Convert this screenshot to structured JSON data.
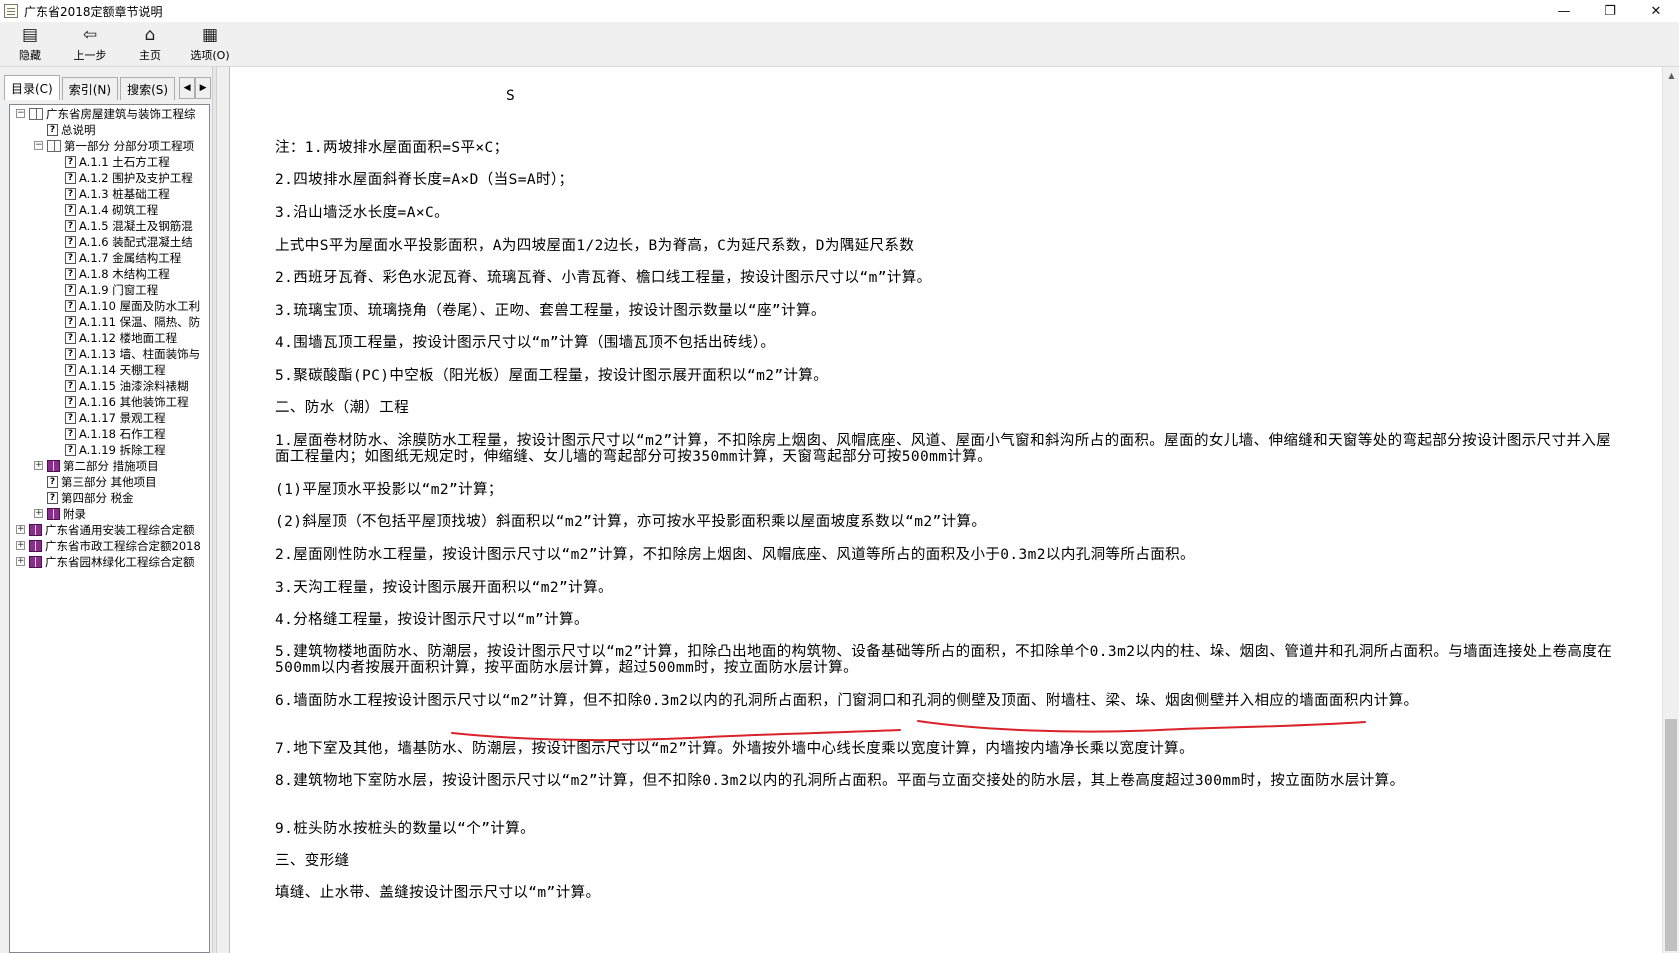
{
  "window": {
    "title": "广东省2018定额章节说明",
    "controls": [
      "—",
      "❐",
      "✕"
    ]
  },
  "toolbar": [
    {
      "label": "隐藏",
      "icon": "hide-icon"
    },
    {
      "label": "上一步",
      "icon": "back-arrow-icon"
    },
    {
      "label": "主页",
      "icon": "home-icon"
    },
    {
      "label": "选项(O)",
      "icon": "options-icon"
    }
  ],
  "nav_tabs": [
    {
      "label": "目录(C)",
      "active": true
    },
    {
      "label": "索引(N)",
      "active": false
    },
    {
      "label": "搜索(S)",
      "active": false
    }
  ],
  "tree": [
    {
      "label": "广东省房屋建筑与装饰工程综",
      "level": 0,
      "type": "book-open",
      "expander": "−"
    },
    {
      "label": "总说明",
      "level": 1,
      "type": "page",
      "expander": ""
    },
    {
      "label": "第一部分 分部分项工程项",
      "level": 1,
      "type": "book-open",
      "expander": "−"
    },
    {
      "label": "A.1.1 土石方工程",
      "level": 2,
      "type": "page",
      "expander": ""
    },
    {
      "label": "A.1.2 围护及支护工程",
      "level": 2,
      "type": "page",
      "expander": ""
    },
    {
      "label": "A.1.3 桩基础工程",
      "level": 2,
      "type": "page",
      "expander": ""
    },
    {
      "label": "A.1.4 砌筑工程",
      "level": 2,
      "type": "page",
      "expander": ""
    },
    {
      "label": "A.1.5 混凝土及钢筋混",
      "level": 2,
      "type": "page",
      "expander": ""
    },
    {
      "label": "A.1.6 装配式混凝土结",
      "level": 2,
      "type": "page",
      "expander": ""
    },
    {
      "label": "A.1.7 金属结构工程",
      "level": 2,
      "type": "page",
      "expander": ""
    },
    {
      "label": "A.1.8 木结构工程",
      "level": 2,
      "type": "page",
      "expander": ""
    },
    {
      "label": "A.1.9 门窗工程",
      "level": 2,
      "type": "page",
      "expander": ""
    },
    {
      "label": "A.1.10 屋面及防水工利",
      "level": 2,
      "type": "page",
      "expander": ""
    },
    {
      "label": "A.1.11 保温、隔热、防",
      "level": 2,
      "type": "page",
      "expander": ""
    },
    {
      "label": "A.1.12 楼地面工程",
      "level": 2,
      "type": "page",
      "expander": ""
    },
    {
      "label": "A.1.13 墙、柱面装饰与",
      "level": 2,
      "type": "page",
      "expander": ""
    },
    {
      "label": "A.1.14 天棚工程",
      "level": 2,
      "type": "page",
      "expander": ""
    },
    {
      "label": "A.1.15 油漆涂料裱糊",
      "level": 2,
      "type": "page",
      "expander": ""
    },
    {
      "label": "A.1.16 其他装饰工程",
      "level": 2,
      "type": "page",
      "expander": ""
    },
    {
      "label": "A.1.17 景观工程",
      "level": 2,
      "type": "page",
      "expander": ""
    },
    {
      "label": "A.1.18 石作工程",
      "level": 2,
      "type": "page",
      "expander": ""
    },
    {
      "label": "A.1.19 拆除工程",
      "level": 2,
      "type": "page",
      "expander": ""
    },
    {
      "label": "第二部分 措施项目",
      "level": 1,
      "type": "book",
      "expander": "+"
    },
    {
      "label": "第三部分 其他项目",
      "level": 1,
      "type": "page",
      "expander": ""
    },
    {
      "label": "第四部分 税金",
      "level": 1,
      "type": "page",
      "expander": ""
    },
    {
      "label": "附录",
      "level": 1,
      "type": "book",
      "expander": "+"
    },
    {
      "label": "广东省通用安装工程综合定额",
      "level": 0,
      "type": "book",
      "expander": "+"
    },
    {
      "label": "广东省市政工程综合定额2018",
      "level": 0,
      "type": "book",
      "expander": "+"
    },
    {
      "label": "广东省园林绿化工程综合定额",
      "level": 0,
      "type": "book",
      "expander": "+"
    }
  ],
  "content": {
    "formula_label": "S",
    "lines": [
      "注：1.两坡排水屋面面积=S平×C；",
      "2.四坡排水屋面斜脊长度=A×D（当S=A时）；",
      "3.沿山墙泛水长度=A×C。",
      "上式中S平为屋面水平投影面积，A为四坡屋面1/2边长，B为脊高，C为延尺系数，D为隅延尺系数",
      "2.西班牙瓦脊、彩色水泥瓦脊、琉璃瓦脊、小青瓦脊、檐口线工程量，按设计图示尺寸以“m”计算。",
      "3.琉璃宝顶、琉璃挠角（卷尾）、正吻、套兽工程量，按设计图示数量以“座”计算。",
      "4.围墙瓦顶工程量，按设计图示尺寸以“m”计算（围墙瓦顶不包括出砖线）。",
      "5.聚碳酸酯(PC)中空板（阳光板）屋面工程量，按设计图示展开面积以“m2”计算。",
      "二、防水（潮）工程",
      "1.屋面卷材防水、涂膜防水工程量，按设计图示尺寸以“m2”计算，不扣除房上烟囱、风帽底座、风道、屋面小气窗和斜沟所占的面积。屋面的女儿墙、伸缩缝和天窗等处的弯起部分按设计图示尺寸并入屋面工程量内；如图纸无规定时，伸缩缝、女儿墙的弯起部分可按350mm计算，天窗弯起部分可按500mm计算。",
      "(1)平屋顶水平投影以“m2”计算；",
      "(2)斜屋顶（不包括平屋顶找坡）斜面积以“m2”计算，亦可按水平投影面积乘以屋面坡度系数以“m2”计算。",
      "2.屋面刚性防水工程量，按设计图示尺寸以“m2”计算，不扣除房上烟囱、风帽底座、风道等所占的面积及小于0.3m2以内孔洞等所占面积。",
      "3.天沟工程量，按设计图示展开面积以“m2”计算。",
      "4.分格缝工程量，按设计图示尺寸以“m”计算。",
      "5.建筑物楼地面防水、防潮层，按设计图示尺寸以“m2”计算，扣除凸出地面的构筑物、设备基础等所占的面积，不扣除单个0.3m2以内的柱、垛、烟囱、管道井和孔洞所占面积。与墙面连接处上卷高度在500mm以内者按展开面积计算，按平面防水层计算，超过500mm时，按立面防水层计算。",
      "6.墙面防水工程按设计图示尺寸以“m2”计算，但不扣除0.3m2以内的孔洞所占面积，门窗洞口和孔洞的侧壁及顶面、附墙柱、梁、垛、烟囱侧壁并入相应的墙面面积内计算。",
      "7.地下室及其他，墙基防水、防潮层，按设计图示尺寸以“m2”计算。外墙按外墙中心线长度乘以宽度计算，内墙按内墙净长乘以宽度计算。",
      "8.建筑物地下室防水层，按设计图示尺寸以“m2”计算，但不扣除0.3m2以内的孔洞所占面积。平面与立面交接处的防水层，其上卷高度超过300mm时，按立面防水层计算。",
      "9.桩头防水按桩头的数量以“个”计算。",
      "三、变形缝",
      "填缝、止水带、盖缝按设计图示尺寸以“m”计算。"
    ]
  },
  "colors": {
    "annotation": "#d9222a",
    "background": "#f0f0f0",
    "content_bg": "#ffffff"
  }
}
